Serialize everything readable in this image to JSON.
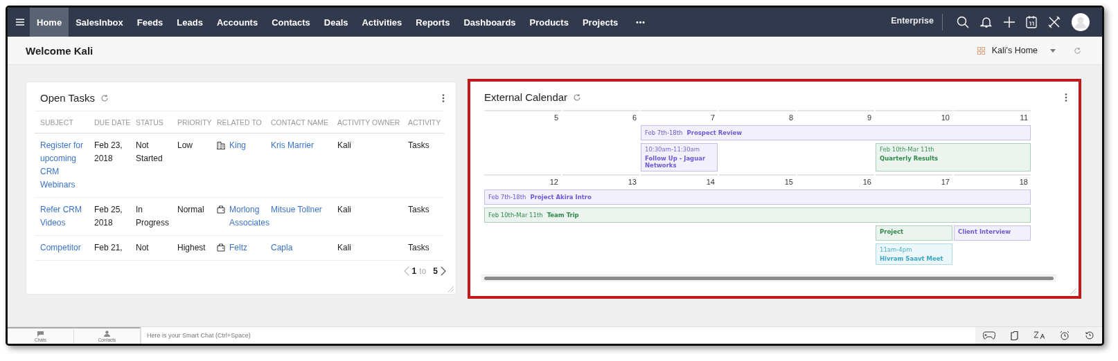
{
  "nav": {
    "tabs": [
      {
        "label": "Home",
        "selected": true
      },
      {
        "label": "SalesInbox",
        "selected": false
      },
      {
        "label": "Feeds",
        "selected": false
      },
      {
        "label": "Leads",
        "selected": false
      },
      {
        "label": "Accounts",
        "selected": false
      },
      {
        "label": "Contacts",
        "selected": false
      },
      {
        "label": "Deals",
        "selected": false
      },
      {
        "label": "Activities",
        "selected": false
      },
      {
        "label": "Reports",
        "selected": false
      },
      {
        "label": "Dashboards",
        "selected": false
      },
      {
        "label": "Products",
        "selected": false
      },
      {
        "label": "Projects",
        "selected": false
      }
    ],
    "more": "•••",
    "edition": "Enterprise"
  },
  "header": {
    "title": "Welcome Kali",
    "home_selector": "Kali's Home"
  },
  "open_tasks": {
    "title": "Open Tasks",
    "highlighted": false,
    "columns": [
      "SUBJECT",
      "DUE DATE",
      "STATUS",
      "PRIORITY",
      "RELATED TO",
      "CONTACT NAME",
      "ACTIVITY OWNER",
      "ACTIVITY"
    ],
    "rows": [
      {
        "subject": "Register for upcoming CRM Webinars",
        "due": "Feb 23, 2018",
        "status": "Not Started",
        "priority": "Low",
        "related": {
          "kind": "building",
          "text": "King"
        },
        "contact": "Kris Marrier",
        "owner": "Kali",
        "type": "Tasks"
      },
      {
        "subject": "Refer CRM Videos",
        "due": "Feb 25, 2018",
        "status": "In Progress",
        "priority": "Normal",
        "related": {
          "kind": "briefcase",
          "text": "Morlong Associates"
        },
        "contact": "Mitsue Tollner",
        "owner": "Kali",
        "type": "Tasks"
      },
      {
        "subject": "Competitor",
        "due": "Feb 21,",
        "status": "Not",
        "priority": "Highest",
        "related": {
          "kind": "briefcase",
          "text": "Feltz"
        },
        "contact": "Capla",
        "owner": "Kali",
        "type": "Tasks"
      }
    ],
    "pager": {
      "from": "1",
      "to_word": "to",
      "to": "5"
    }
  },
  "external_calendar": {
    "title": "External Calendar",
    "highlighted": true,
    "weeks": [
      {
        "days": [
          "5",
          "6",
          "7",
          "8",
          "9",
          "10",
          "11"
        ],
        "rows": [
          [
            {
              "kind": "empty"
            },
            {
              "kind": "empty"
            },
            {
              "kind": "banner",
              "when": "Feb 7th-18th",
              "title": "Prospect Review",
              "color": "#6b5bd6"
            },
            {
              "kind": "continued"
            },
            {
              "kind": "continued"
            },
            {
              "kind": "continued"
            },
            {
              "kind": "continued"
            }
          ],
          [
            {
              "kind": "empty"
            },
            {
              "kind": "empty"
            },
            {
              "kind": "block",
              "when": "10:30am-11:30am",
              "title": "Follow Up - Jaguar Networks",
              "color": "#6b5bd6"
            },
            {
              "kind": "empty"
            },
            {
              "kind": "empty"
            },
            {
              "kind": "block",
              "when": "Feb 10th-Mar 11th",
              "title": "Quarterly Results",
              "color": "#2f8a4a"
            },
            {
              "kind": "continued"
            }
          ]
        ]
      },
      {
        "days": [
          "12",
          "13",
          "14",
          "15",
          "16",
          "17",
          "18"
        ],
        "rows": [
          [
            {
              "kind": "banner",
              "when": "Feb 7th-18th",
              "title": "Project Akira Intro",
              "color": "#6b5bd6"
            },
            {
              "kind": "continued"
            },
            {
              "kind": "continued"
            },
            {
              "kind": "continued"
            },
            {
              "kind": "continued"
            },
            {
              "kind": "continued"
            },
            {
              "kind": "continued"
            }
          ],
          [
            {
              "kind": "banner",
              "when": "Feb 10th-Mar 11th",
              "title": "Team Trip",
              "color": "#2f8a4a"
            },
            {
              "kind": "continued"
            },
            {
              "kind": "continued"
            },
            {
              "kind": "continued"
            },
            {
              "kind": "continued"
            },
            {
              "kind": "continued"
            },
            {
              "kind": "continued"
            }
          ],
          [
            {
              "kind": "empty"
            },
            {
              "kind": "empty"
            },
            {
              "kind": "empty"
            },
            {
              "kind": "empty"
            },
            {
              "kind": "empty"
            },
            {
              "kind": "block",
              "title": "Project",
              "color": "#2f8a4a"
            },
            {
              "kind": "block",
              "title": "Client Interview",
              "color": "#6b5bd6"
            }
          ],
          [
            {
              "kind": "empty"
            },
            {
              "kind": "empty"
            },
            {
              "kind": "empty"
            },
            {
              "kind": "empty"
            },
            {
              "kind": "empty"
            },
            {
              "kind": "block",
              "when": "11am-4pm",
              "title": "Hivram Saavt Meet",
              "color": "#3aa6c4"
            },
            {
              "kind": "empty"
            }
          ]
        ]
      }
    ]
  },
  "footer": {
    "tabs": [
      "Chats",
      "Contacts"
    ],
    "chat_placeholder": "Here is your Smart Chat (Ctrl+Space)"
  }
}
